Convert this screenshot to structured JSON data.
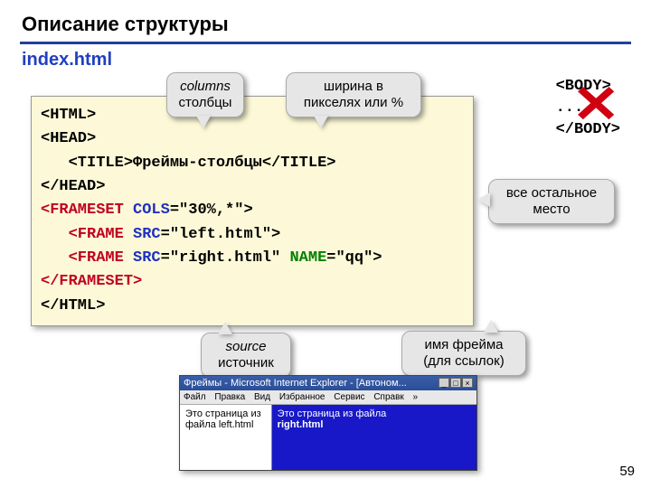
{
  "title": "Описание структуры",
  "filename": "index.html",
  "code": {
    "l1": "<HTML>",
    "l2": "<HEAD>",
    "l3a": "   <TITLE>",
    "l3b": "Фреймы-столбцы",
    "l3c": "</TITLE>",
    "l4": "</HEAD>",
    "l5a": "<FRAMESET",
    "l5b": " COLS",
    "l5c": "=\"30%,*\">",
    "l6a": "   <FRAME",
    "l6b": " SRC",
    "l6c": "=\"left.html\">",
    "l7a": "   <FRAME",
    "l7b": " SRC",
    "l7c": "=\"right.html\"",
    "l7d": " NAME",
    "l7e": "=\"qq\">",
    "l8": "</FRAMESET>",
    "l9": "</HTML>"
  },
  "callouts": {
    "columns_en": "columns",
    "columns_ru": "столбцы",
    "width": "ширина в пикселях или %",
    "rest": "все остальное место",
    "source_en": "source",
    "source_ru": "источник",
    "framename": "имя фрейма (для ссылок)"
  },
  "body_block": {
    "open": "<BODY>",
    "dots": "...",
    "close": "</BODY>"
  },
  "browser": {
    "title": "Фреймы - Microsoft Internet Explorer - [Автоном...",
    "menu": [
      "Файл",
      "Правка",
      "Вид",
      "Избранное",
      "Сервис",
      "Справк"
    ],
    "left_text": "Это страница из файла left.html",
    "right_text_a": "Это страница из файла",
    "right_text_b": "right.html"
  },
  "page_number": "59"
}
